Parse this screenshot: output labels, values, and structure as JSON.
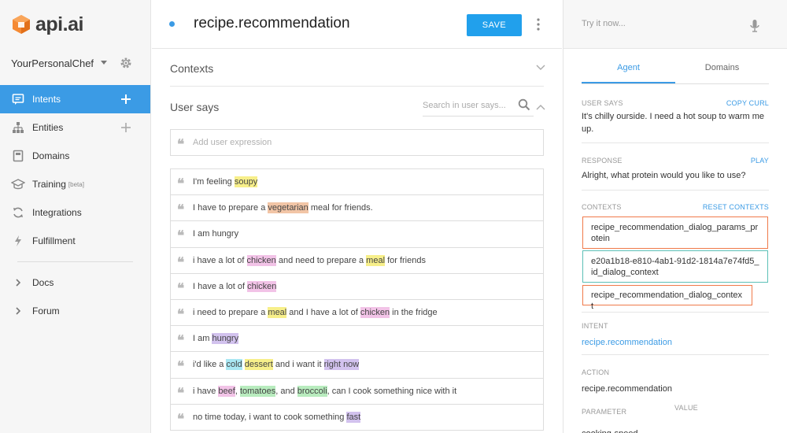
{
  "sidebar": {
    "logo_text": "api.ai",
    "agent_name": "YourPersonalChef",
    "nav": [
      {
        "label": "Intents",
        "icon": "chat-bubble-icon",
        "active": true,
        "add": true
      },
      {
        "label": "Entities",
        "icon": "hierarchy-icon",
        "active": false,
        "add": true
      },
      {
        "label": "Domains",
        "icon": "book-icon",
        "active": false,
        "add": false
      },
      {
        "label": "Training",
        "badge": "[beta]",
        "icon": "graduation-cap-icon",
        "active": false,
        "add": false
      },
      {
        "label": "Integrations",
        "icon": "sync-icon",
        "active": false,
        "add": false
      },
      {
        "label": "Fulfillment",
        "icon": "lightning-icon",
        "active": false,
        "add": false
      }
    ],
    "secondary": [
      {
        "label": "Docs",
        "icon": "chevron-right-icon"
      },
      {
        "label": "Forum",
        "icon": "chevron-right-icon"
      }
    ]
  },
  "main": {
    "intent_title": "recipe.recommendation",
    "save_label": "SAVE",
    "contexts_label": "Contexts",
    "user_says_label": "User says",
    "search_placeholder": "Search in user says...",
    "add_expression_placeholder": "Add user expression",
    "expressions": [
      [
        {
          "t": "I'm feeling "
        },
        {
          "t": "soupy",
          "c": "yellow"
        }
      ],
      [
        {
          "t": "I have to prepare a "
        },
        {
          "t": "vegetarian",
          "c": "orange"
        },
        {
          "t": " meal for friends."
        }
      ],
      [
        {
          "t": "I am hungry"
        }
      ],
      [
        {
          "t": "i have a lot of "
        },
        {
          "t": "chicken",
          "c": "pink"
        },
        {
          "t": " and need to prepare a "
        },
        {
          "t": "meal",
          "c": "yellow"
        },
        {
          "t": " for friends"
        }
      ],
      [
        {
          "t": "I have a lot of "
        },
        {
          "t": "chicken",
          "c": "pink"
        }
      ],
      [
        {
          "t": "i need to prepare a "
        },
        {
          "t": "meal",
          "c": "yellow"
        },
        {
          "t": " and I have a lot of "
        },
        {
          "t": "chicken",
          "c": "pink"
        },
        {
          "t": " in the fridge"
        }
      ],
      [
        {
          "t": "I am "
        },
        {
          "t": "hungry",
          "c": "purple"
        }
      ],
      [
        {
          "t": "i'd like a "
        },
        {
          "t": "cold",
          "c": "blue"
        },
        {
          "t": " "
        },
        {
          "t": "dessert",
          "c": "yellow"
        },
        {
          "t": " and i want it "
        },
        {
          "t": "right now",
          "c": "purple"
        }
      ],
      [
        {
          "t": "i have "
        },
        {
          "t": "beef",
          "c": "pink"
        },
        {
          "t": ", "
        },
        {
          "t": "tomatoes",
          "c": "green"
        },
        {
          "t": ", and "
        },
        {
          "t": "broccoli",
          "c": "green"
        },
        {
          "t": ", can I cook something nice with it"
        }
      ],
      [
        {
          "t": "no time today, i want to cook something "
        },
        {
          "t": "fast",
          "c": "purple"
        }
      ]
    ]
  },
  "right": {
    "try_placeholder": "Try it now...",
    "tab_agent": "Agent",
    "tab_domains": "Domains",
    "user_says_label": "USER SAYS",
    "copy_curl": "COPY CURL",
    "user_says_text": "It's chilly ourside. I need a hot soup to warm me up.",
    "response_label": "RESPONSE",
    "play": "PLAY",
    "response_text": "Alright, what protein would you like to use?",
    "contexts_label": "CONTEXTS",
    "reset_contexts": "RESET CONTEXTS",
    "contexts": [
      "recipe_recommendation_dialog_params_protein",
      "e20a1b18-e810-4ab1-91d2-1814a7e74fd5_id_dialog_context",
      "recipe_recommendation_dialog_context"
    ],
    "intent_label": "INTENT",
    "intent_value": "recipe.recommendation",
    "action_label": "ACTION",
    "action_value": "recipe.recommendation",
    "parameter_label": "PARAMETER",
    "value_label": "VALUE",
    "parameter_value": "cooking-speed"
  }
}
